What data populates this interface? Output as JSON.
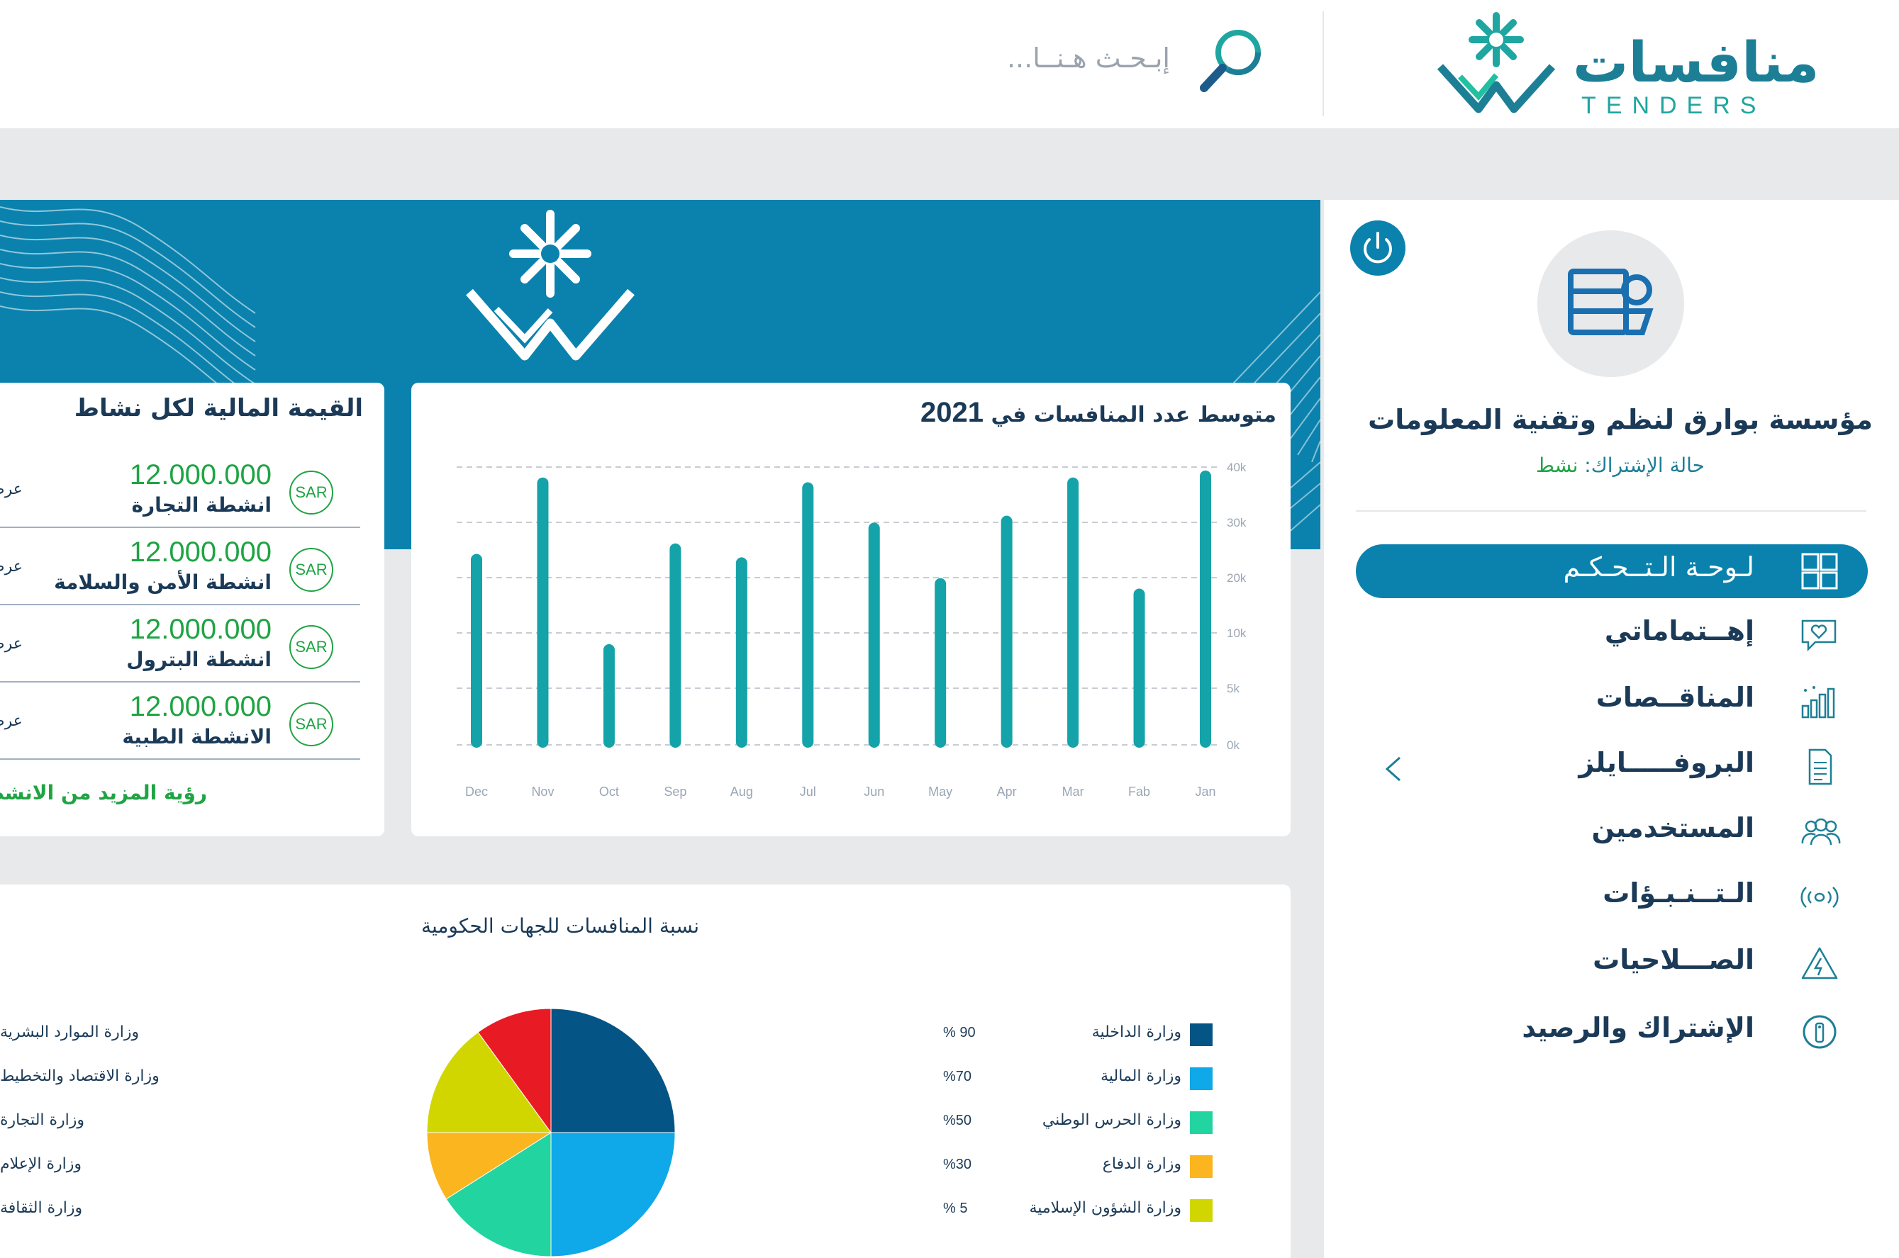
{
  "header": {
    "logo_ar": "منافسات",
    "logo_en": "TENDERS",
    "search_placeholder": "إبـحـث هـنــا..."
  },
  "sidebar": {
    "org_name": "مؤسسة بوارق لنظم وتقنية المعلومات",
    "status_label": "حالة الإشتراك:",
    "status_value": "نشط",
    "items": [
      {
        "label": "لـوحـة الـتــحـكـم",
        "icon": "grid-icon",
        "active": true
      },
      {
        "label": "إهــتماماتي",
        "icon": "heart-chat-icon"
      },
      {
        "label": "المناقــصات",
        "icon": "bar-chart-icon"
      },
      {
        "label": "البروفـــــايلز",
        "icon": "document-icon"
      },
      {
        "label": "المستخدمين",
        "icon": "users-icon"
      },
      {
        "label": "الـتــنـبـؤات",
        "icon": "target-icon"
      },
      {
        "label": "الصـــلاحيات",
        "icon": "warning-icon"
      },
      {
        "label": "الإشتراك والرصيد",
        "icon": "info-icon"
      }
    ]
  },
  "activities": {
    "title": "القيمة المالية لكل نشاط",
    "currency": "SAR",
    "view_label": "عرض",
    "rows": [
      {
        "amount": "12.000.000",
        "name": "انشطة التجارة"
      },
      {
        "amount": "12.000.000",
        "name": "انشطة الأمن والسلامة"
      },
      {
        "amount": "12.000.000",
        "name": "انشطة البترول"
      },
      {
        "amount": "12.000.000",
        "name": "الانشطة الطبية"
      }
    ],
    "see_more": "رؤية المزيد من الانشطة"
  },
  "bar_title": {
    "text": "متوسط عدد المنافسات في",
    "year": "2021"
  },
  "pie_title": "نسبة المنافسات للجهات الحكومية",
  "chart_data": [
    {
      "type": "bar",
      "title": "متوسط عدد المنافسات في 2021",
      "categories": [
        "Jan",
        "Fab",
        "Mar",
        "Apr",
        "May",
        "Jun",
        "Jul",
        "Aug",
        "Sep",
        "Oct",
        "Nov",
        "Dec"
      ],
      "values": [
        39500,
        22500,
        38500,
        33000,
        24000,
        32000,
        37800,
        27000,
        29000,
        14500,
        38500,
        27500
      ],
      "yticks": [
        "40k",
        "30k",
        "20k",
        "10k",
        "5k",
        "0k"
      ],
      "ylim": [
        0,
        40000
      ],
      "grid": true,
      "color": "#14a3a8"
    },
    {
      "type": "pie",
      "title": "نسبة المنافسات للجهات الحكومية",
      "slices": [
        {
          "label": "وزارة الداخلية",
          "value": 25,
          "color": "#045485"
        },
        {
          "label": "وزارة المالية",
          "value": 25,
          "color": "#0fa8e8"
        },
        {
          "label": "وزارة الحرس الوطني",
          "value": 16,
          "color": "#22d4a0"
        },
        {
          "label": "وزارة الدفاع",
          "value": 9,
          "color": "#fab51f"
        },
        {
          "label": "وزارة الشؤون الإسلامية",
          "value": 15,
          "color": "#d2d600"
        },
        {
          "label": "",
          "value": 10,
          "color": "#e81b24"
        }
      ]
    }
  ],
  "pie_legend": [
    {
      "label": "وزارة الداخلية",
      "pct": "% 90",
      "color": "#045485"
    },
    {
      "label": "وزارة المالية",
      "pct": "%70",
      "color": "#0fa8e8"
    },
    {
      "label": "وزارة الحرس الوطني",
      "pct": "%50",
      "color": "#22d4a0"
    },
    {
      "label": "وزارة الدفاع",
      "pct": "%30",
      "color": "#fab51f"
    },
    {
      "label": "وزارة الشؤون الإسلامية",
      "pct": "% 5",
      "color": "#d2d600"
    }
  ],
  "pie_legend_left": [
    "وزارة الموارد البشرية",
    "وزارة الاقتصاد والتخطيط",
    "وزارة التجارة",
    "وزارة الإعلام",
    "وزارة الثقافة"
  ]
}
